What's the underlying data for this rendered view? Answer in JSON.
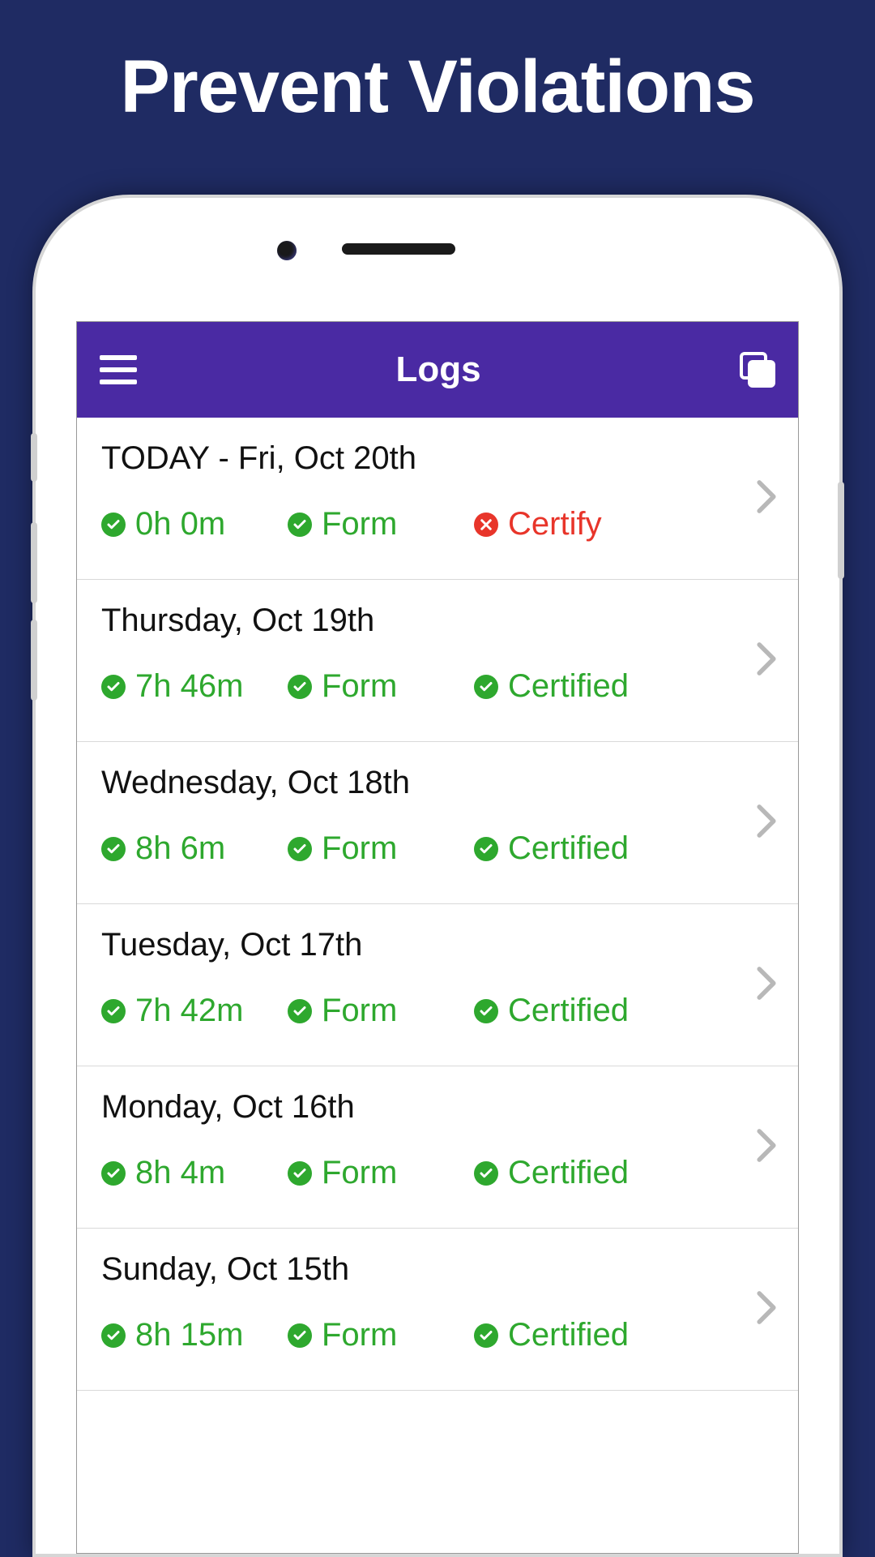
{
  "hero": {
    "title": "Prevent Violations"
  },
  "header": {
    "title": "Logs"
  },
  "logs": [
    {
      "date": "TODAY - Fri, Oct 20th",
      "duration": "0h 0m",
      "duration_status": "ok",
      "form_label": "Form",
      "form_status": "ok",
      "certify_label": "Certify",
      "certify_status": "bad"
    },
    {
      "date": "Thursday, Oct 19th",
      "duration": "7h 46m",
      "duration_status": "ok",
      "form_label": "Form",
      "form_status": "ok",
      "certify_label": "Certified",
      "certify_status": "ok"
    },
    {
      "date": "Wednesday, Oct 18th",
      "duration": "8h 6m",
      "duration_status": "ok",
      "form_label": "Form",
      "form_status": "ok",
      "certify_label": "Certified",
      "certify_status": "ok"
    },
    {
      "date": "Tuesday, Oct 17th",
      "duration": "7h 42m",
      "duration_status": "ok",
      "form_label": "Form",
      "form_status": "ok",
      "certify_label": "Certified",
      "certify_status": "ok"
    },
    {
      "date": "Monday, Oct 16th",
      "duration": "8h 4m",
      "duration_status": "ok",
      "form_label": "Form",
      "form_status": "ok",
      "certify_label": "Certified",
      "certify_status": "ok"
    },
    {
      "date": "Sunday, Oct 15th",
      "duration": "8h 15m",
      "duration_status": "ok",
      "form_label": "Form",
      "form_status": "ok",
      "certify_label": "Certified",
      "certify_status": "ok"
    }
  ]
}
